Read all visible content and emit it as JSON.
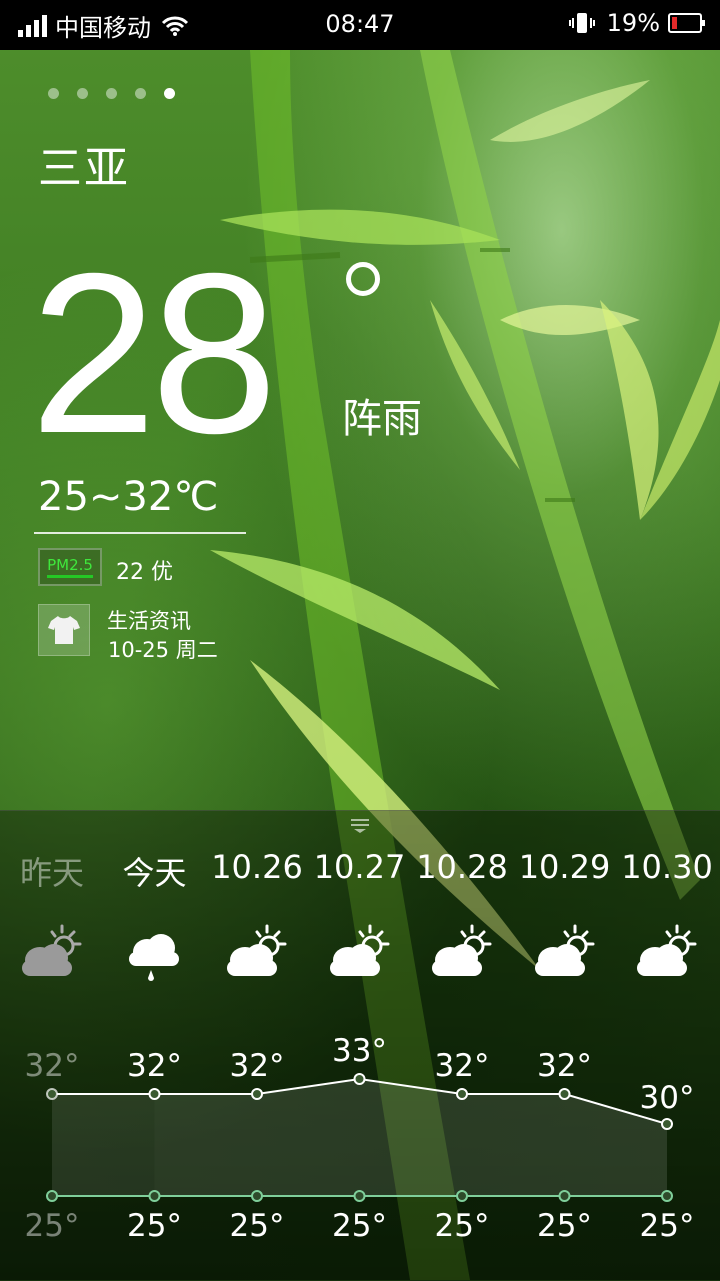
{
  "status_bar": {
    "carrier": "中国移动",
    "time": "08:47",
    "battery_percent": "19%",
    "battery_level": 0.19,
    "battery_color": "#e32a2a"
  },
  "pager": {
    "pages": 5,
    "current": 5
  },
  "current": {
    "city": "三亚",
    "temperature": "28",
    "condition": "阵雨",
    "range": "25~32℃",
    "pm25_label": "PM2.5",
    "pm25_value": "22  优",
    "life_title": "生活资讯",
    "life_date": "10-25 周二"
  },
  "forecast": [
    {
      "day": "昨天",
      "icon": "partly-cloudy-icon",
      "high": "32°",
      "low": "25°",
      "high_value": 32,
      "low_value": 25,
      "dimmed": true
    },
    {
      "day": "今天",
      "icon": "rain-shower-icon",
      "high": "32°",
      "low": "25°",
      "high_value": 32,
      "low_value": 25,
      "dimmed": false
    },
    {
      "day": "10.26",
      "icon": "partly-cloudy-icon",
      "high": "32°",
      "low": "25°",
      "high_value": 32,
      "low_value": 25,
      "dimmed": false
    },
    {
      "day": "10.27",
      "icon": "partly-cloudy-icon",
      "high": "33°",
      "low": "25°",
      "high_value": 33,
      "low_value": 25,
      "dimmed": false
    },
    {
      "day": "10.28",
      "icon": "partly-cloudy-icon",
      "high": "32°",
      "low": "25°",
      "high_value": 32,
      "low_value": 25,
      "dimmed": false
    },
    {
      "day": "10.29",
      "icon": "partly-cloudy-icon",
      "high": "32°",
      "low": "25°",
      "high_value": 32,
      "low_value": 25,
      "dimmed": false
    },
    {
      "day": "10.30",
      "icon": "partly-cloudy-icon",
      "high": "30°",
      "low": "25°",
      "high_value": 30,
      "low_value": 25,
      "dimmed": false
    }
  ],
  "colors": {
    "pm25_text": "#3fe63c",
    "pm25_bar": "#25c825",
    "high_line": "#ffffff",
    "low_line": "#7fcf9a"
  }
}
